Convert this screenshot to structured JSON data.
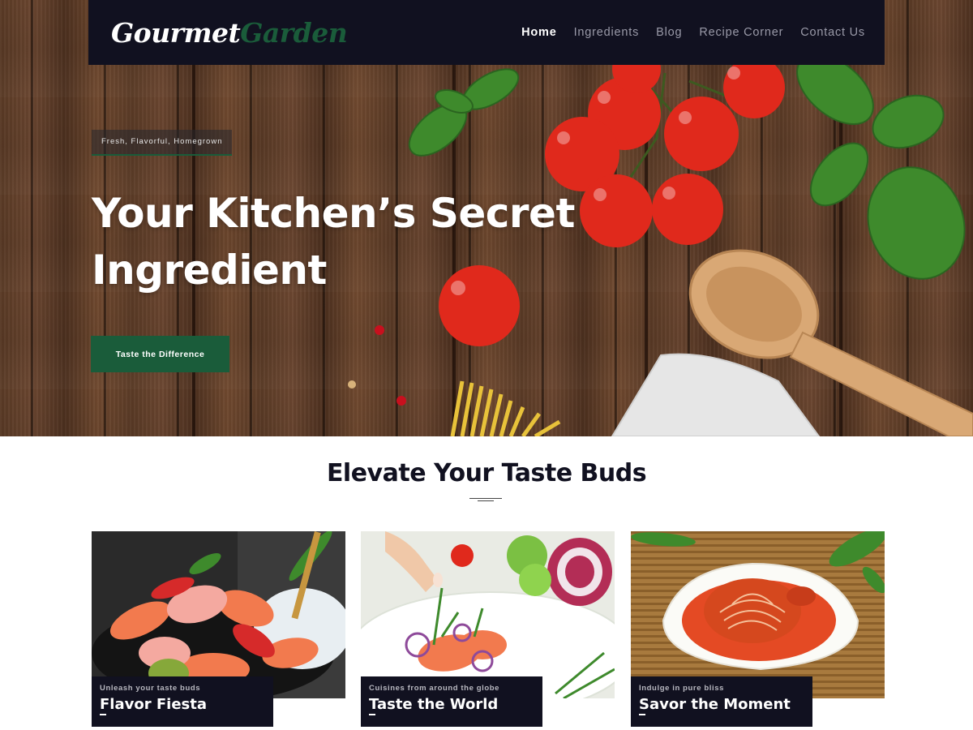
{
  "brand": {
    "logo_part1": "Gourmet",
    "logo_part2": "Garden"
  },
  "nav": {
    "items": [
      {
        "label": "Home",
        "active": true
      },
      {
        "label": "Ingredients",
        "active": false
      },
      {
        "label": "Blog",
        "active": false
      },
      {
        "label": "Recipe Corner",
        "active": false
      },
      {
        "label": "Contact Us",
        "active": false
      }
    ]
  },
  "hero": {
    "tagline": "Fresh, Flavorful, Homegrown",
    "headline_line1": "Your Kitchen’s Secret",
    "headline_line2": "Ingredient",
    "cta_label": "Taste the Difference"
  },
  "section": {
    "title": "Elevate Your Taste Buds"
  },
  "cards": [
    {
      "subtitle": "Unleash your taste buds",
      "title": "Flavor Fiesta"
    },
    {
      "subtitle": "Cuisines from around the globe",
      "title": "Taste the World"
    },
    {
      "subtitle": "Indulge in pure bliss",
      "title": "Savor the Moment"
    }
  ],
  "colors": {
    "navbar_bg": "#111120",
    "brand_green": "#1a5c3a",
    "heading_dark": "#111120",
    "nav_inactive": "#9a9aa8"
  }
}
